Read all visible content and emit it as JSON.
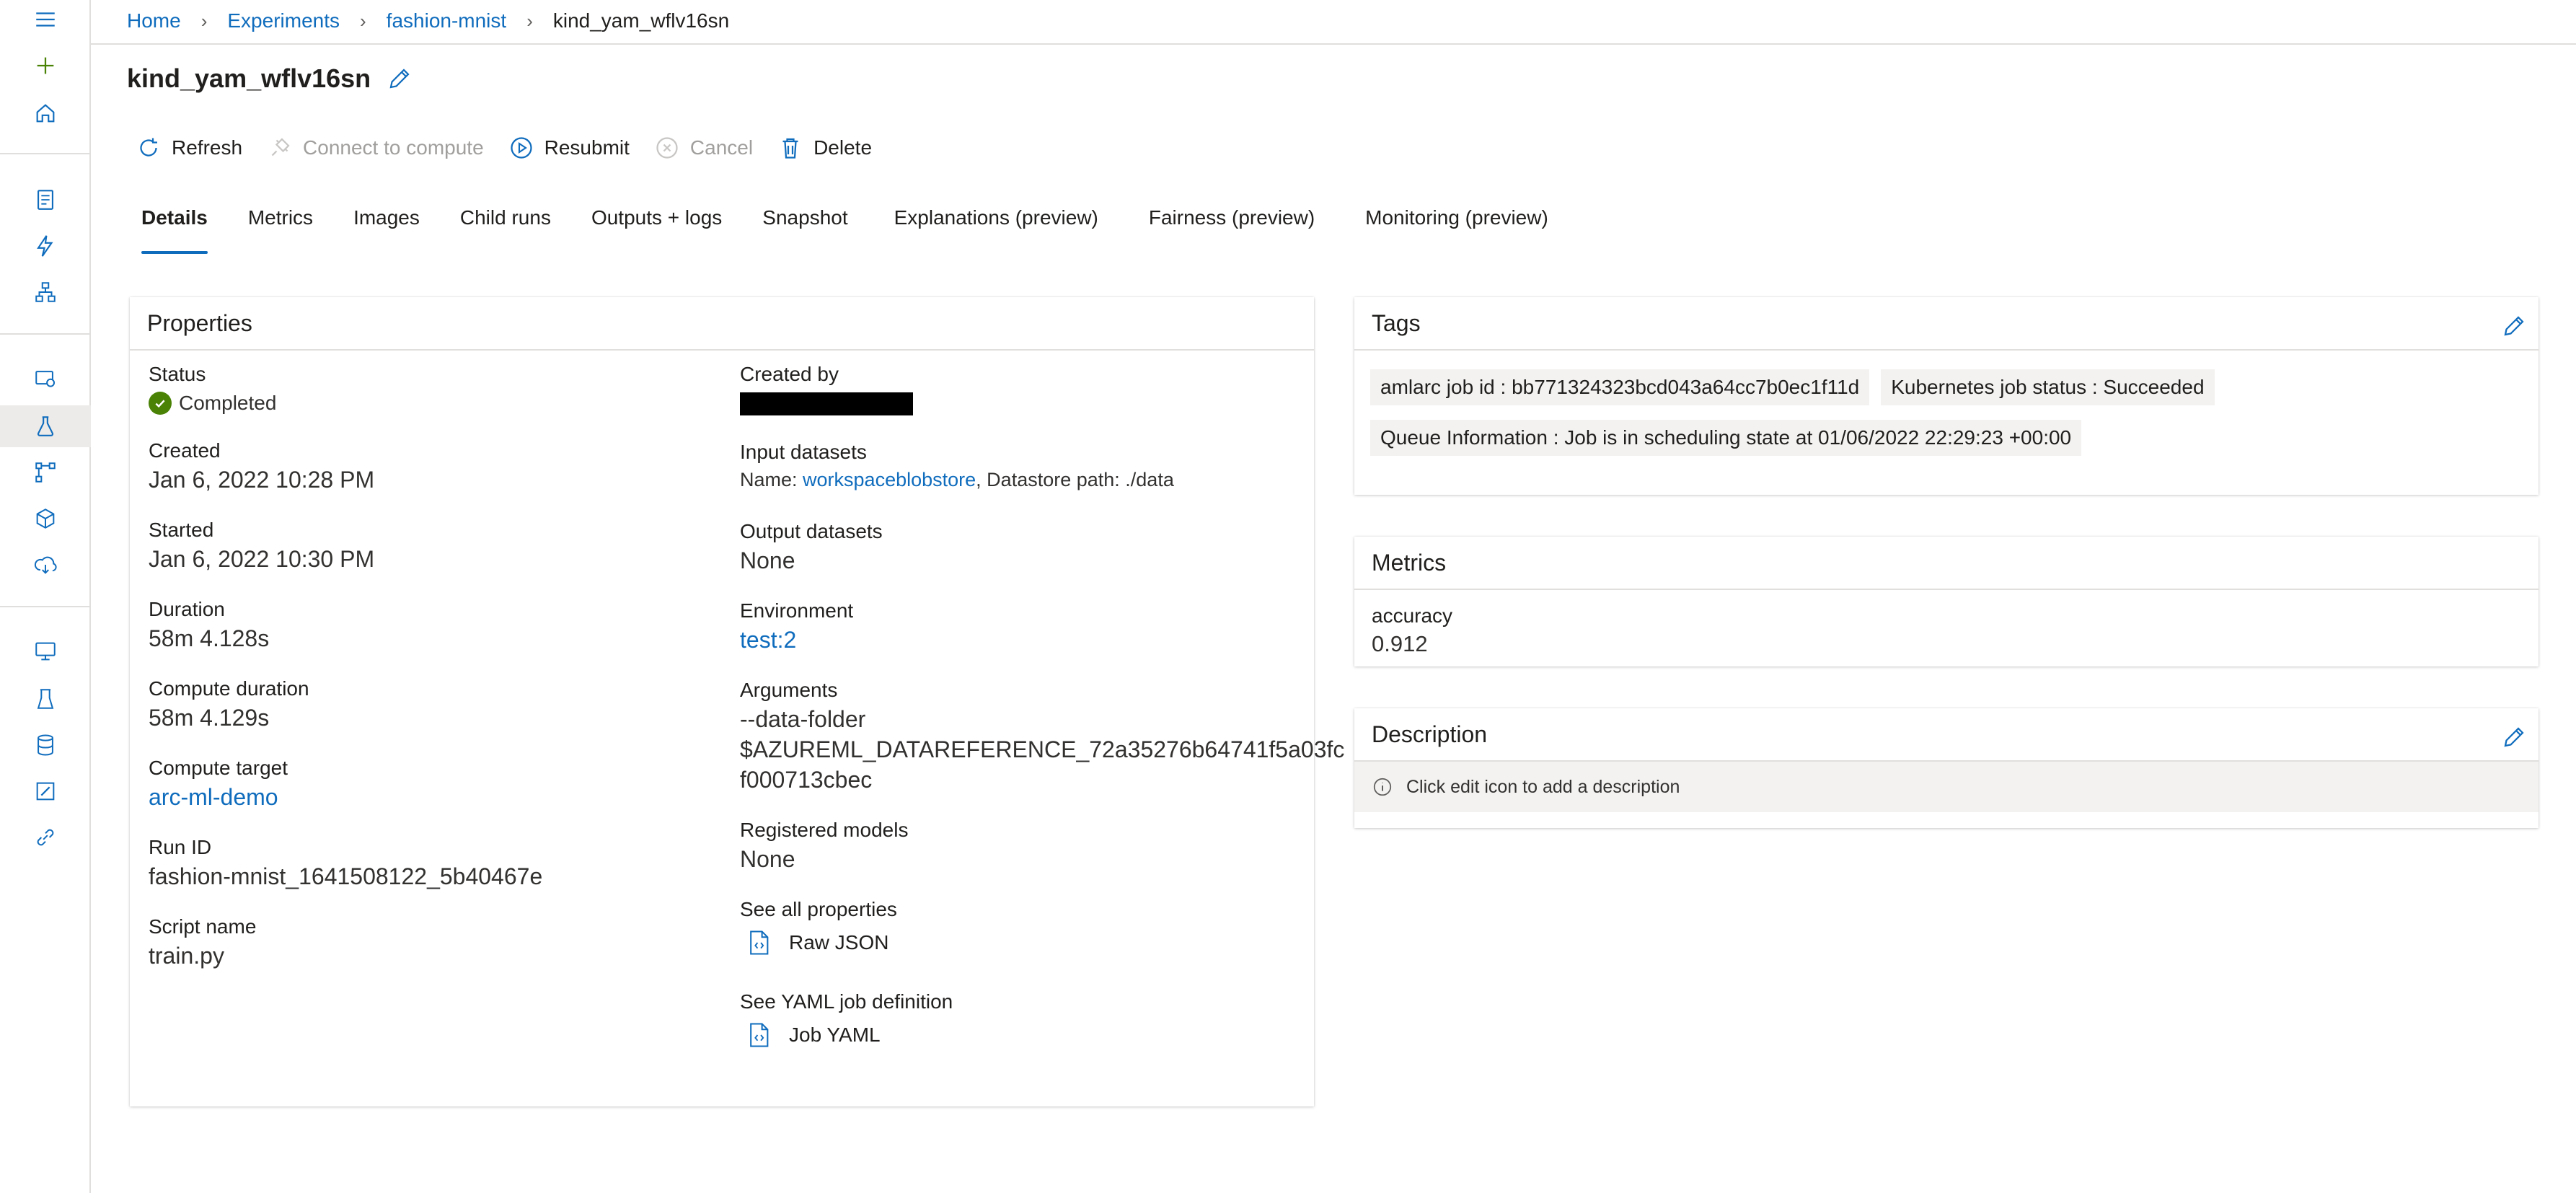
{
  "breadcrumb": {
    "home": "Home",
    "experiments": "Experiments",
    "experiment": "fashion-mnist",
    "current": "kind_yam_wflv16sn"
  },
  "title": "kind_yam_wflv16sn",
  "toolbar": {
    "refresh": "Refresh",
    "connect": "Connect to compute",
    "resubmit": "Resubmit",
    "cancel": "Cancel",
    "delete": "Delete"
  },
  "tabs": [
    "Details",
    "Metrics",
    "Images",
    "Child runs",
    "Outputs + logs",
    "Snapshot",
    "Explanations (preview)",
    "Fairness (preview)",
    "Monitoring (preview)"
  ],
  "properties": {
    "heading": "Properties",
    "status_label": "Status",
    "status_value": "Completed",
    "created_label": "Created",
    "created_value": "Jan 6, 2022 10:28 PM",
    "started_label": "Started",
    "started_value": "Jan 6, 2022 10:30 PM",
    "duration_label": "Duration",
    "duration_value": "58m 4.128s",
    "compute_duration_label": "Compute duration",
    "compute_duration_value": "58m 4.129s",
    "compute_target_label": "Compute target",
    "compute_target_value": "arc-ml-demo",
    "run_id_label": "Run ID",
    "run_id_value": "fashion-mnist_1641508122_5b40467e",
    "script_name_label": "Script name",
    "script_name_value": "train.py",
    "created_by_label": "Created by",
    "input_datasets_label": "Input datasets",
    "input_name_prefix": "Name: ",
    "input_name_link": "workspaceblobstore",
    "input_datastore": ", Datastore path: ./data",
    "output_datasets_label": "Output datasets",
    "output_datasets_value": "None",
    "environment_label": "Environment",
    "environment_value": "test:2",
    "arguments_label": "Arguments",
    "arguments_line1": "--data-folder",
    "arguments_line2": "$AZUREML_DATAREFERENCE_72a35276b64741f5a03fc",
    "arguments_line3": "f000713cbec",
    "registered_models_label": "Registered models",
    "registered_models_value": "None",
    "see_all_label": "See all properties",
    "raw_json": "Raw JSON",
    "see_yaml_label": "See YAML job definition",
    "job_yaml": "Job YAML"
  },
  "tags": {
    "heading": "Tags",
    "items": [
      "amlarc job id : bb771324323bcd043a64cc7b0ec1f11d",
      "Kubernetes job status : Succeeded",
      "Queue Information : Job is in scheduling state at 01/06/2022 22:29:23 +00:00"
    ]
  },
  "metrics": {
    "heading": "Metrics",
    "name": "accuracy",
    "value": "0.912"
  },
  "description": {
    "heading": "Description",
    "hint": "Click edit icon to add a description"
  },
  "colors": {
    "accent": "#0f6cbd",
    "success": "#498205",
    "text": "#201f1e",
    "border": "#e1dfdd"
  }
}
